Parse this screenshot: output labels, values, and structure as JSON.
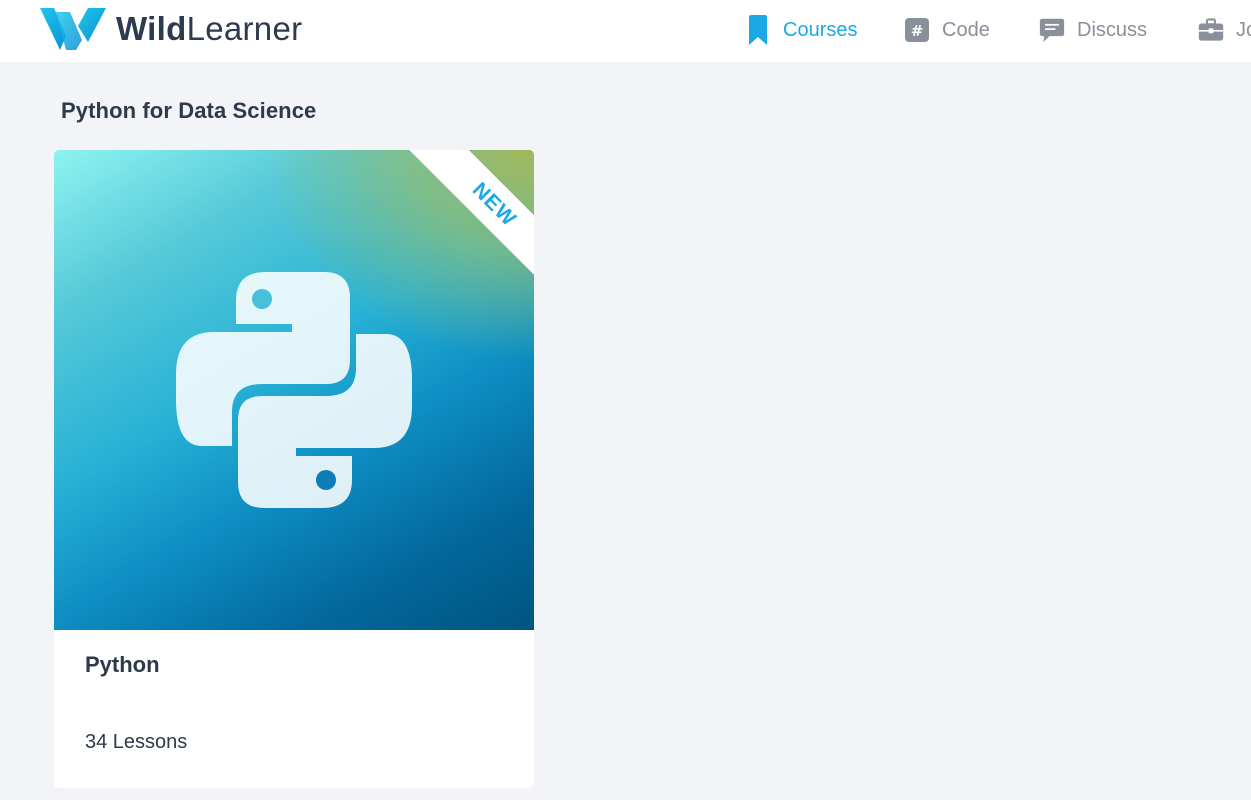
{
  "brand": {
    "name_bold": "Wild",
    "name_light": "Learner",
    "logo_icon": "wildlearner-logo-icon",
    "colors": {
      "accent": "#1aa9e6",
      "text": "#2e3a4a",
      "muted": "#8a9099",
      "background": "#f2f4f7"
    }
  },
  "nav": {
    "items": [
      {
        "label": "Courses",
        "icon": "bookmark-icon",
        "active": true
      },
      {
        "label": "Code",
        "icon": "hash-icon",
        "active": false
      },
      {
        "label": "Discuss",
        "icon": "chat-icon",
        "active": false
      },
      {
        "label": "Jobs",
        "icon": "briefcase-icon",
        "active": false
      }
    ]
  },
  "section": {
    "title": "Python for Data Science"
  },
  "courses": [
    {
      "title": "Python",
      "lessons": "34 Lessons",
      "badge": "NEW",
      "image_icon": "python-logo-icon"
    }
  ]
}
